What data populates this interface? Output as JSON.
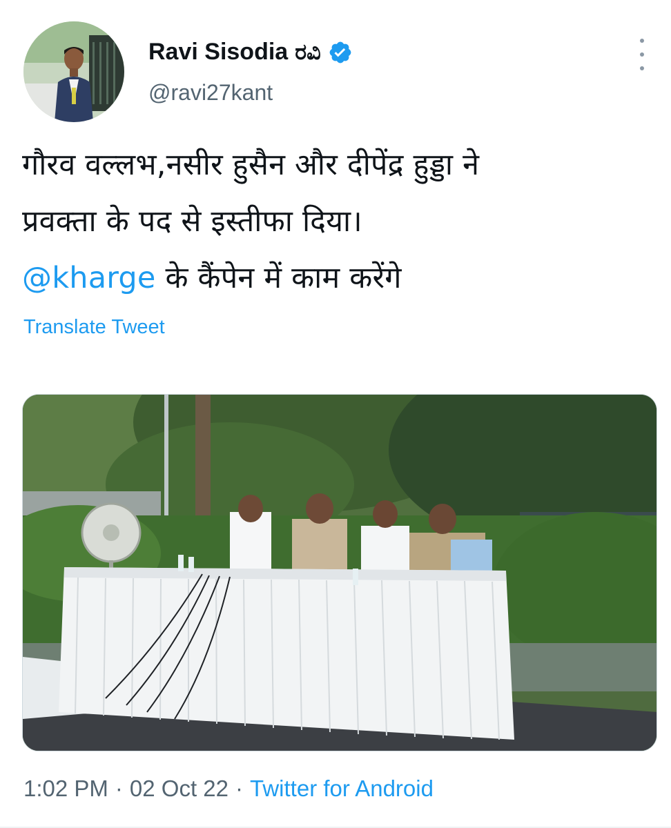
{
  "author": {
    "display_name": "Ravi Sisodia",
    "name_suffix": "ರವಿ",
    "handle": "@ravi27kant",
    "verified": true
  },
  "tweet": {
    "line1": "गौरव वल्लभ,नसीर हुसैन और दीपेंद्र हुड्डा ने",
    "line2": "प्रवक्ता के पद से इस्तीफा दिया।",
    "mention": "@kharge",
    "line3_rest": " के कैंपेन में काम करेंगे",
    "translate_label": "Translate Tweet"
  },
  "meta": {
    "time": "1:02 PM",
    "separator1": "·",
    "date": "02 Oct 22",
    "separator2": "·",
    "source": "Twitter for Android"
  },
  "icons": {
    "verified": "verified-badge-icon",
    "more": "more-options-icon"
  },
  "colors": {
    "accent": "#1d9bf0",
    "text": "#0f1419",
    "secondary": "#536471"
  }
}
